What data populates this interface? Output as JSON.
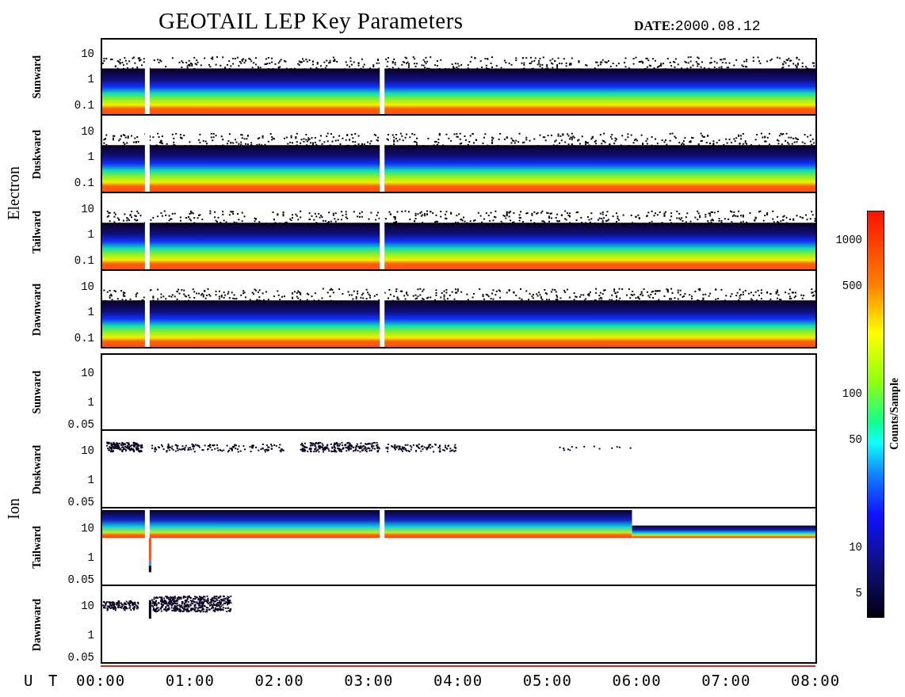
{
  "title": "GEOTAIL LEP Key Parameters",
  "date": {
    "label": "DATE:",
    "value": "2000.08.12"
  },
  "groups": [
    {
      "label": "Electron",
      "kind": "electron",
      "panels": [
        {
          "label": "Sunward",
          "kind": "electron",
          "yticks": [
            "10",
            "1",
            "0.1"
          ]
        },
        {
          "label": "Duskward",
          "kind": "electron",
          "yticks": [
            "10",
            "1",
            "0.1"
          ]
        },
        {
          "label": "Tailward",
          "kind": "electron",
          "yticks": [
            "10",
            "1",
            "0.1"
          ]
        },
        {
          "label": "Dawnward",
          "kind": "electron",
          "yticks": [
            "10",
            "1",
            "0.1"
          ]
        }
      ]
    },
    {
      "label": "Ion",
      "kind": "ion",
      "panels": [
        {
          "label": "Sunward",
          "kind": "empty",
          "yticks": [
            "10",
            "1",
            "0.05"
          ]
        },
        {
          "label": "Duskward",
          "kind": "sparse",
          "yticks": [
            "10",
            "1",
            "0.05"
          ]
        },
        {
          "label": "Tailward",
          "kind": "band",
          "yticks": [
            "10",
            "1",
            "0.05"
          ]
        },
        {
          "label": "Dawnward",
          "kind": "clusters",
          "yticks": [
            "10",
            "1",
            "0.05"
          ]
        }
      ]
    }
  ],
  "colorbar": {
    "label": "Counts/Sample",
    "ticks": [
      "1000",
      "500",
      "100",
      "50",
      "10",
      "5"
    ]
  },
  "time_axis": {
    "label": "U T",
    "ticks": [
      "00:00",
      "01:00",
      "02:00",
      "03:00",
      "04:00",
      "05:00",
      "06:00",
      "07:00",
      "08:00"
    ]
  }
}
